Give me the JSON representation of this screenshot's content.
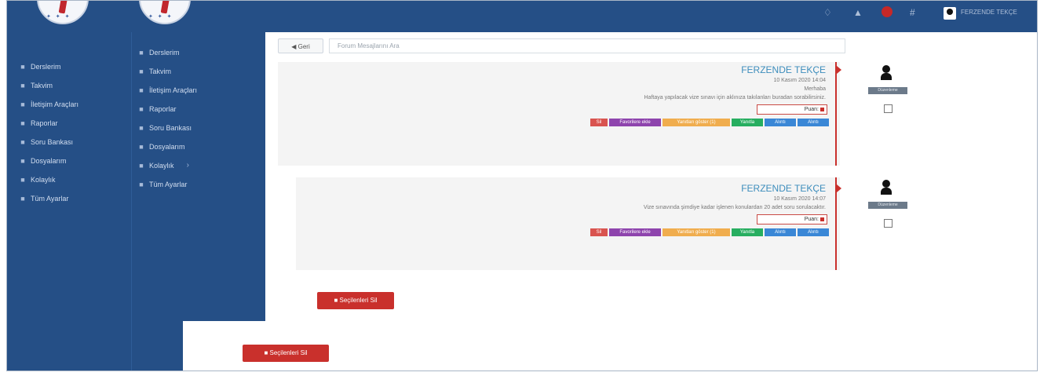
{
  "header": {
    "icons": [
      "bell-icon",
      "warning-icon",
      "flag-icon",
      "grid-icon"
    ],
    "user_name": "FERZENDE TEKÇE"
  },
  "sidebar": {
    "items": [
      {
        "icon": "book-icon",
        "label": "Derslerim"
      },
      {
        "icon": "calendar-icon",
        "label": "Takvim"
      },
      {
        "icon": "chat-icon",
        "label": "İletişim Araçları"
      },
      {
        "icon": "chart-icon",
        "label": "Raporlar"
      },
      {
        "icon": "database-icon",
        "label": "Soru Bankası"
      },
      {
        "icon": "files-icon",
        "label": "Dosyalarım"
      },
      {
        "icon": "search-icon",
        "label": "Kolaylık"
      },
      {
        "icon": "wrench-icon",
        "label": "Tüm Ayarlar"
      }
    ]
  },
  "sidebar2": {
    "items": [
      {
        "label": "Derslerim"
      },
      {
        "label": "Takvim"
      },
      {
        "label": "İletişim Araçları"
      },
      {
        "label": "Raporlar"
      },
      {
        "label": "Soru Bankası"
      },
      {
        "label": "Dosyalarım"
      },
      {
        "label": "Kolaylık"
      },
      {
        "label": "Tüm Ayarlar"
      }
    ]
  },
  "toolbar": {
    "back_label": "Geri",
    "search_placeholder": "Forum Mesajlarını Ara"
  },
  "messages": [
    {
      "author": "FERZENDE TEKÇE",
      "date": "10 Kasım 2020 14:04",
      "greeting": "Merhaba",
      "body": "Haftaya yapılacak vize sınavı için aklınıza takılanları buradan sorabilirsiniz.",
      "puan_label": "Puan:",
      "selection_label": "Düzenleme",
      "buttons": [
        {
          "label": "Sil",
          "color": "#d9534f"
        },
        {
          "label": "Favorilere ekle",
          "color": "#8e44ad"
        },
        {
          "label": "Yanıtları göster (1)",
          "color": "#f0ad4e"
        },
        {
          "label": "Yanıtla",
          "color": "#27ae60"
        },
        {
          "label": "Alıntı",
          "color": "#3a87d6"
        },
        {
          "label": "Alıntı",
          "color": "#3a87d6"
        }
      ]
    },
    {
      "author": "FERZENDE TEKÇE",
      "date": "10 Kasım 2020 14:07",
      "greeting": "",
      "body": "Vize sınavında şimdiye kadar işlenen konulardan 20 adet soru sorulacaktır.",
      "puan_label": "Puan:",
      "selection_label": "Düzenleme",
      "buttons": [
        {
          "label": "Sil",
          "color": "#d9534f"
        },
        {
          "label": "Favorilere ekle",
          "color": "#8e44ad"
        },
        {
          "label": "Yanıtları göster (1)",
          "color": "#f0ad4e"
        },
        {
          "label": "Yanıtla",
          "color": "#27ae60"
        },
        {
          "label": "Alıntı",
          "color": "#3a87d6"
        },
        {
          "label": "Alıntı",
          "color": "#3a87d6"
        }
      ]
    }
  ],
  "actions": {
    "delete_selected": "Seçilenleri Sil",
    "delete_selected_zoom": "Seçilenleri Sil"
  },
  "colors": {
    "nav_bg": "#254f86",
    "accent_red": "#c9302c",
    "author_blue": "#3c8dbc"
  }
}
